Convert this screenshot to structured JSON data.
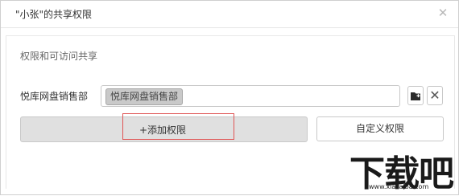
{
  "dialog": {
    "title": "\"小张\"的共享权限",
    "close_icon": "close-icon"
  },
  "section": {
    "title": "权限和可访问共享"
  },
  "share_group": {
    "label": "悦库网盘销售部",
    "tags": [
      "悦库网盘销售部"
    ],
    "folder_icon": "folder-plus-icon",
    "remove_icon": "close-icon"
  },
  "actions": {
    "add_label": "+添加权限",
    "custom_label": "自定义权限",
    "highlight_color": "#e05555"
  },
  "watermark": {
    "main": "下载吧",
    "url": "www.xiazaiba.com"
  }
}
